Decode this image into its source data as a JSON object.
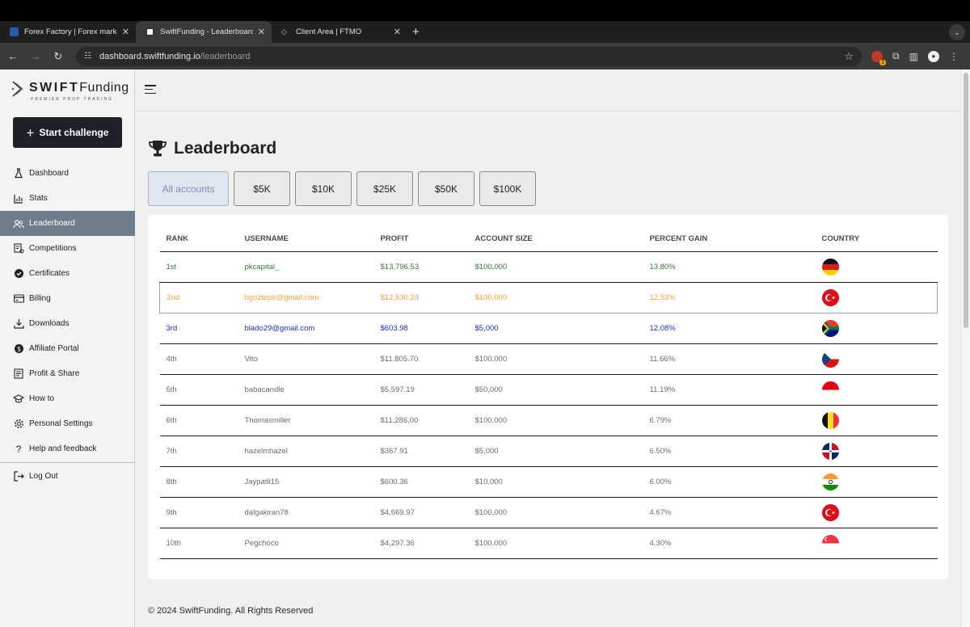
{
  "browser": {
    "tabs": [
      {
        "title": "Forex Factory | Forex markets",
        "favicon": "forexfactory-icon",
        "active": false
      },
      {
        "title": "SwiftFunding - Leaderboard",
        "favicon": "swiftfunding-icon",
        "active": true
      },
      {
        "title": "Client Area | FTMO",
        "favicon": "ftmo-icon",
        "active": false
      }
    ],
    "url_host": "dashboard.swiftfunding.io",
    "url_path": "/leaderboard",
    "extension_badge": "1"
  },
  "sidebar": {
    "logo_bold": "SWIFT",
    "logo_light": "Funding",
    "logo_tagline": "PREMIER PROP TRADING",
    "start_button": "Start challenge",
    "items": [
      {
        "label": "Dashboard",
        "icon": "flask-icon"
      },
      {
        "label": "Stats",
        "icon": "bar-chart-icon"
      },
      {
        "label": "Leaderboard",
        "icon": "users-icon",
        "active": true
      },
      {
        "label": "Competitions",
        "icon": "competition-icon"
      },
      {
        "label": "Certificates",
        "icon": "badge-check-icon"
      },
      {
        "label": "Billing",
        "icon": "credit-card-icon"
      },
      {
        "label": "Downloads",
        "icon": "download-icon"
      },
      {
        "label": "Affiliate Portal",
        "icon": "dollar-coin-icon"
      },
      {
        "label": "Profit & Share",
        "icon": "document-icon"
      },
      {
        "label": "How to",
        "icon": "graduation-cap-icon"
      },
      {
        "label": "Personal Settings",
        "icon": "gear-icon"
      },
      {
        "label": "Help and feedback",
        "icon": "question-icon"
      }
    ],
    "logout": "Log Out"
  },
  "main": {
    "title": "Leaderboard",
    "filters": [
      "All accounts",
      "$5K",
      "$10K",
      "$25K",
      "$50K",
      "$100K"
    ],
    "columns": [
      "RANK",
      "USERNAME",
      "PROFIT",
      "ACCOUNT SIZE",
      "PERCENT GAIN",
      "COUNTRY"
    ],
    "rows": [
      {
        "rank": "1st",
        "username": "pkcapital_",
        "profit": "$13,796.53",
        "size": "$100,000",
        "gain": "13.80%",
        "flag": "germany-flag"
      },
      {
        "rank": "2nd",
        "username": "bgoztepe@gmail.com",
        "profit": "$12,530.24",
        "size": "$100,000",
        "gain": "12.53%",
        "flag": "turkey-flag"
      },
      {
        "rank": "3rd",
        "username": "blado29@gmail.com",
        "profit": "$603.98",
        "size": "$5,000",
        "gain": "12.08%",
        "flag": "south-africa-flag"
      },
      {
        "rank": "4th",
        "username": "Vito",
        "profit": "$11,805.70",
        "size": "$100,000",
        "gain": "11.66%",
        "flag": "czech-flag"
      },
      {
        "rank": "5th",
        "username": "babacandle",
        "profit": "$5,597.19",
        "size": "$50,000",
        "gain": "11.19%",
        "flag": "indonesia-flag"
      },
      {
        "rank": "6th",
        "username": "Thomasmiller",
        "profit": "$11,286.00",
        "size": "$100,000",
        "gain": "6.79%",
        "flag": "belgium-flag"
      },
      {
        "rank": "7th",
        "username": "hazelmhazel",
        "profit": "$367.91",
        "size": "$5,000",
        "gain": "6.50%",
        "flag": "dominican-flag"
      },
      {
        "rank": "8th",
        "username": "Jaypatil15",
        "profit": "$600.36",
        "size": "$10,000",
        "gain": "6.00%",
        "flag": "india-flag"
      },
      {
        "rank": "9th",
        "username": "dalgakiran78",
        "profit": "$4,669.97",
        "size": "$100,000",
        "gain": "4.67%",
        "flag": "turkey-flag"
      },
      {
        "rank": "10th",
        "username": "Pegchoco",
        "profit": "$4,297.36",
        "size": "$100,000",
        "gain": "4.30%",
        "flag": "singapore-flag"
      }
    ]
  },
  "footer": "© 2024 SwiftFunding. All Rights Reserved"
}
